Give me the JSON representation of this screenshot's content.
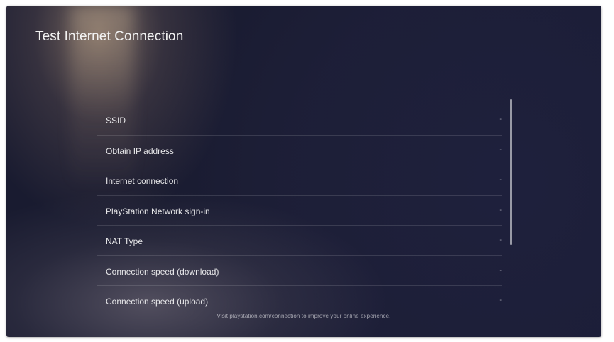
{
  "screen": {
    "title": "Test Internet Connection"
  },
  "results": [
    {
      "label": "SSID",
      "value": "-"
    },
    {
      "label": "Obtain IP address",
      "value": "-"
    },
    {
      "label": "Internet connection",
      "value": "-"
    },
    {
      "label": "PlayStation Network sign-in",
      "value": "-"
    },
    {
      "label": "NAT Type",
      "value": "-"
    },
    {
      "label": "Connection speed (download)",
      "value": "-"
    },
    {
      "label": "Connection speed (upload)",
      "value": "-"
    }
  ],
  "footer": {
    "text": "Visit playstation.com/connection to improve your online experience."
  },
  "colors": {
    "background_dark": "#1e2040",
    "text_primary": "#e6e6e8"
  }
}
